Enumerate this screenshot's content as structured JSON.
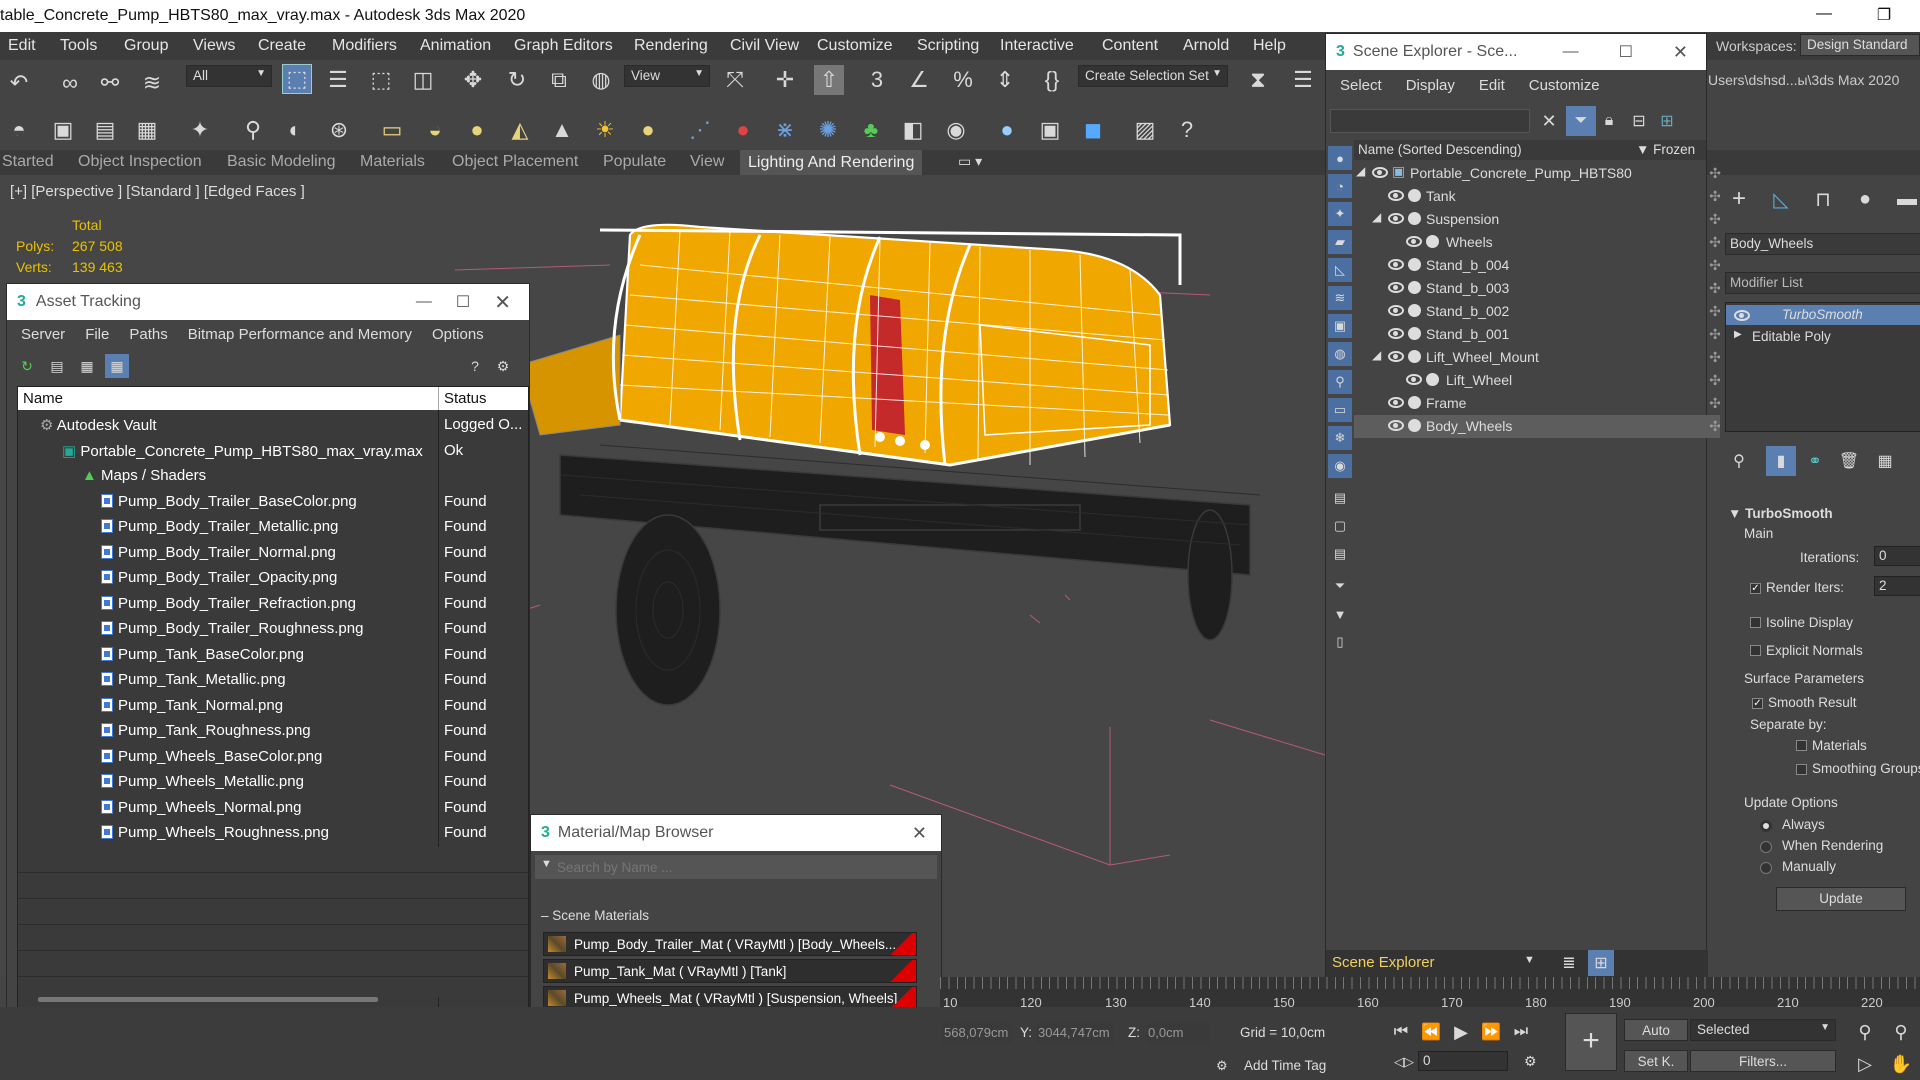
{
  "window": {
    "title": "table_Concrete_Pump_HBTS80_max_vray.max - Autodesk 3ds Max 2020",
    "minimize": "—",
    "restore": "❐"
  },
  "menu": [
    "Edit",
    "Tools",
    "Group",
    "Views",
    "Create",
    "Modifiers",
    "Animation",
    "Graph Editors",
    "Rendering",
    "Civil View",
    "Customize",
    "Scripting",
    "Interactive",
    "Content",
    "Arnold",
    "Help"
  ],
  "toolbar": {
    "filter": "All",
    "view_dropdown": "View",
    "selection_set": "Create Selection Set",
    "workspaces_label": "Workspaces:",
    "workspace_value": "Design Standard",
    "path": "Users\\dshsd...ы\\3ds Max 2020"
  },
  "ribbon": {
    "tabs": [
      "Started",
      "Object Inspection",
      "Basic Modeling",
      "Materials",
      "Object Placement",
      "Populate",
      "View",
      "Lighting And Rendering"
    ],
    "active": "Lighting And Rendering"
  },
  "viewport": {
    "label": "[+] [Perspective ] [Standard ] [Edged Faces ]",
    "stats": {
      "total": "Total",
      "polys_label": "Polys:",
      "polys": "267 508",
      "verts_label": "Verts:",
      "verts": "139 463"
    }
  },
  "asset_tracking": {
    "title": "Asset Tracking",
    "menu": [
      "Server",
      "File",
      "Paths",
      "Bitmap Performance and Memory",
      "Options"
    ],
    "columns": {
      "name": "Name",
      "status": "Status"
    },
    "rows": [
      {
        "name": "Autodesk Vault",
        "status": "Logged O..."
      },
      {
        "name": "Portable_Concrete_Pump_HBTS80_max_vray.max",
        "status": "Ok"
      },
      {
        "name": "Maps / Shaders",
        "status": ""
      },
      {
        "name": "Pump_Body_Trailer_BaseColor.png",
        "status": "Found"
      },
      {
        "name": "Pump_Body_Trailer_Metallic.png",
        "status": "Found"
      },
      {
        "name": "Pump_Body_Trailer_Normal.png",
        "status": "Found"
      },
      {
        "name": "Pump_Body_Trailer_Opacity.png",
        "status": "Found"
      },
      {
        "name": "Pump_Body_Trailer_Refraction.png",
        "status": "Found"
      },
      {
        "name": "Pump_Body_Trailer_Roughness.png",
        "status": "Found"
      },
      {
        "name": "Pump_Tank_BaseColor.png",
        "status": "Found"
      },
      {
        "name": "Pump_Tank_Metallic.png",
        "status": "Found"
      },
      {
        "name": "Pump_Tank_Normal.png",
        "status": "Found"
      },
      {
        "name": "Pump_Tank_Roughness.png",
        "status": "Found"
      },
      {
        "name": "Pump_Wheels_BaseColor.png",
        "status": "Found"
      },
      {
        "name": "Pump_Wheels_Metallic.png",
        "status": "Found"
      },
      {
        "name": "Pump_Wheels_Normal.png",
        "status": "Found"
      },
      {
        "name": "Pump_Wheels_Roughness.png",
        "status": "Found"
      }
    ]
  },
  "material_browser": {
    "title": "Material/Map Browser",
    "search_placeholder": "Search by Name ...",
    "section": "Scene Materials",
    "items": [
      "Pump_Body_Trailer_Mat  ( VRayMtl )  [Body_Wheels...",
      "Pump_Tank_Mat  ( VRayMtl )  [Tank]",
      "Pump_Wheels_Mat  ( VRayMtl )  [Suspension, Wheels]"
    ]
  },
  "scene_explorer": {
    "title": "Scene Explorer - Sce...",
    "menu": [
      "Select",
      "Display",
      "Edit",
      "Customize"
    ],
    "header_name": "Name (Sorted Descending)",
    "header_frozen": "Frozen",
    "items": [
      "Portable_Concrete_Pump_HBTS80",
      "Tank",
      "Suspension",
      "Wheels",
      "Stand_b_004",
      "Stand_b_003",
      "Stand_b_002",
      "Stand_b_001",
      "Lift_Wheel_Mount",
      "Lift_Wheel",
      "Frame",
      "Body_Wheels"
    ],
    "footer": "Scene Explorer"
  },
  "command_panel": {
    "object_name": "Body_Wheels",
    "modifier_list": "Modifier List",
    "stack": [
      "TurboSmooth",
      "Editable Poly"
    ],
    "rollout": "TurboSmooth",
    "main": "Main",
    "iterations_label": "Iterations:",
    "iterations": "0",
    "render_iters_label": "Render Iters:",
    "render_iters": "2",
    "isoline": "Isoline Display",
    "explicit_normals": "Explicit Normals",
    "surface_params": "Surface Parameters",
    "smooth_result": "Smooth Result",
    "separate_by": "Separate by:",
    "materials": "Materials",
    "smoothing_groups": "Smoothing Groups",
    "update_options": "Update Options",
    "always": "Always",
    "when_rendering": "When Rendering",
    "manually": "Manually",
    "update_btn": "Update"
  },
  "timeline": {
    "ticks": [
      "10",
      "120",
      "130",
      "140",
      "150",
      "160",
      "170",
      "180",
      "190",
      "200",
      "210",
      "220"
    ]
  },
  "status": {
    "x": "568,079cm",
    "y_label": "Y:",
    "y": "3044,747cm",
    "z_label": "Z:",
    "z": "0,0cm",
    "grid": "Grid = 10,0cm",
    "add_time_tag": "Add Time Tag",
    "auto": "Auto",
    "set_key": "Set K.",
    "selected": "Selected",
    "filters": "Filters...",
    "frame": "0"
  }
}
